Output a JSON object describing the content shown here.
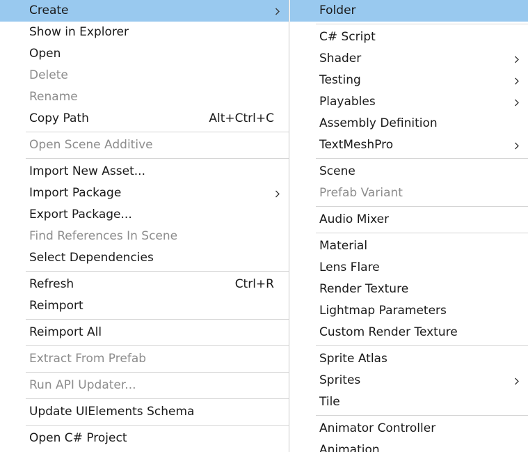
{
  "left_menu": [
    {
      "type": "item",
      "label": "Create",
      "submenu": true,
      "highlight": true
    },
    {
      "type": "item",
      "label": "Show in Explorer"
    },
    {
      "type": "item",
      "label": "Open"
    },
    {
      "type": "item",
      "label": "Delete",
      "disabled": true
    },
    {
      "type": "item",
      "label": "Rename",
      "disabled": true
    },
    {
      "type": "item",
      "label": "Copy Path",
      "shortcut": "Alt+Ctrl+C"
    },
    {
      "type": "sep"
    },
    {
      "type": "item",
      "label": "Open Scene Additive",
      "disabled": true
    },
    {
      "type": "sep"
    },
    {
      "type": "item",
      "label": "Import New Asset..."
    },
    {
      "type": "item",
      "label": "Import Package",
      "submenu": true
    },
    {
      "type": "item",
      "label": "Export Package..."
    },
    {
      "type": "item",
      "label": "Find References In Scene",
      "disabled": true
    },
    {
      "type": "item",
      "label": "Select Dependencies"
    },
    {
      "type": "sep"
    },
    {
      "type": "item",
      "label": "Refresh",
      "shortcut": "Ctrl+R"
    },
    {
      "type": "item",
      "label": "Reimport"
    },
    {
      "type": "sep"
    },
    {
      "type": "item",
      "label": "Reimport All"
    },
    {
      "type": "sep"
    },
    {
      "type": "item",
      "label": "Extract From Prefab",
      "disabled": true
    },
    {
      "type": "sep"
    },
    {
      "type": "item",
      "label": "Run API Updater...",
      "disabled": true
    },
    {
      "type": "sep"
    },
    {
      "type": "item",
      "label": "Update UIElements Schema"
    },
    {
      "type": "sep"
    },
    {
      "type": "item",
      "label": "Open C# Project"
    }
  ],
  "right_menu": [
    {
      "type": "item",
      "label": "Folder",
      "highlight": true
    },
    {
      "type": "sep"
    },
    {
      "type": "item",
      "label": "C# Script"
    },
    {
      "type": "item",
      "label": "Shader",
      "submenu": true
    },
    {
      "type": "item",
      "label": "Testing",
      "submenu": true
    },
    {
      "type": "item",
      "label": "Playables",
      "submenu": true
    },
    {
      "type": "item",
      "label": "Assembly Definition"
    },
    {
      "type": "item",
      "label": "TextMeshPro",
      "submenu": true
    },
    {
      "type": "sep"
    },
    {
      "type": "item",
      "label": "Scene"
    },
    {
      "type": "item",
      "label": "Prefab Variant",
      "disabled": true
    },
    {
      "type": "sep"
    },
    {
      "type": "item",
      "label": "Audio Mixer"
    },
    {
      "type": "sep"
    },
    {
      "type": "item",
      "label": "Material"
    },
    {
      "type": "item",
      "label": "Lens Flare"
    },
    {
      "type": "item",
      "label": "Render Texture"
    },
    {
      "type": "item",
      "label": "Lightmap Parameters"
    },
    {
      "type": "item",
      "label": "Custom Render Texture"
    },
    {
      "type": "sep"
    },
    {
      "type": "item",
      "label": "Sprite Atlas"
    },
    {
      "type": "item",
      "label": "Sprites",
      "submenu": true
    },
    {
      "type": "item",
      "label": "Tile"
    },
    {
      "type": "sep"
    },
    {
      "type": "item",
      "label": "Animator Controller"
    },
    {
      "type": "item",
      "label": "Animation"
    }
  ],
  "colors": {
    "highlight": "#99c9ef",
    "disabled_text": "#8d8d8d",
    "separator": "#d5d5d5"
  },
  "icons": {
    "submenu": "chevron-right-icon"
  }
}
